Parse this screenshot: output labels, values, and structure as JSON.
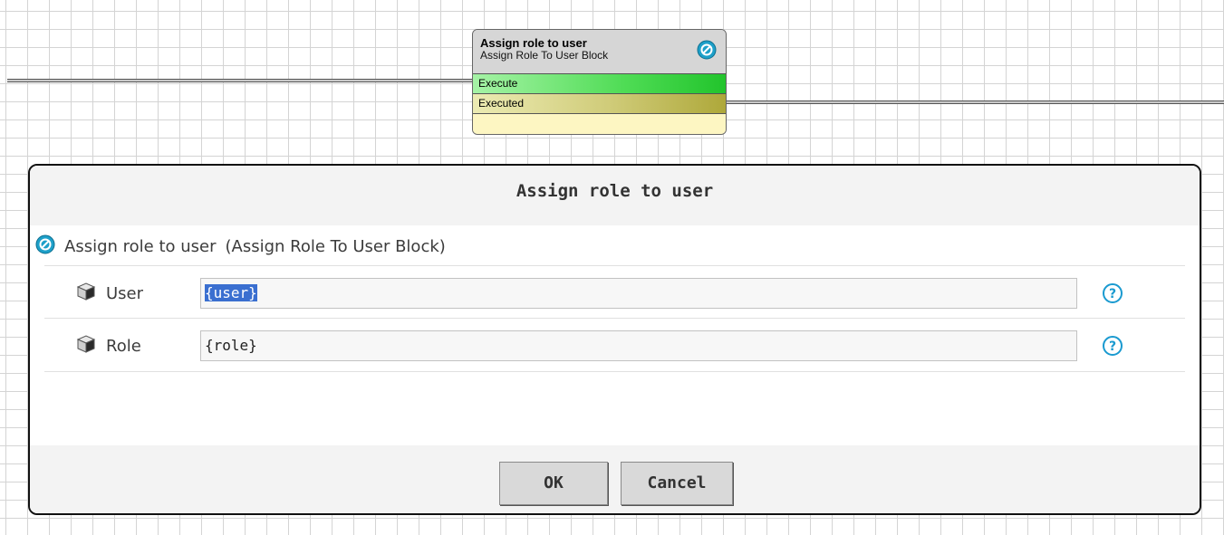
{
  "block": {
    "title": "Assign role to user",
    "subtitle": "Assign Role To User Block",
    "rows": [
      "Execute",
      "Executed"
    ],
    "icon": "no-entry-icon"
  },
  "dialog": {
    "title": "Assign role to user",
    "header_name": "Assign role to user",
    "header_type": "(Assign Role To User Block)",
    "fields": [
      {
        "label": "User",
        "value": "{user}",
        "icon": "cube-icon",
        "help_icon": "help-icon"
      },
      {
        "label": "Role",
        "value": "{role}",
        "icon": "cube-icon",
        "help_icon": "help-icon"
      }
    ],
    "ok_label": "OK",
    "cancel_label": "Cancel"
  },
  "colors": {
    "accent": "#1ea0c9",
    "execute_green": "#22c42c",
    "executed_olive": "#aea83a",
    "selection": "#3a6fd0"
  }
}
